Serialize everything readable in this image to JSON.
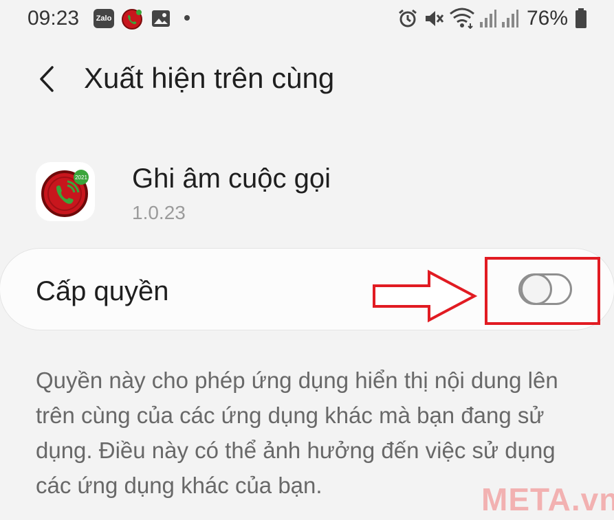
{
  "status_bar": {
    "time": "09:23",
    "zalo_label": "Zalo",
    "battery": "76%"
  },
  "header": {
    "title": "Xuất hiện trên cùng"
  },
  "app": {
    "name": "Ghi âm cuộc gọi",
    "version": "1.0.23",
    "icon_badge": "2021"
  },
  "permission": {
    "label": "Cấp quyền",
    "enabled": false
  },
  "description": "Quyền này cho phép ứng dụng hiển thị nội dung lên trên cùng của các ứng dụng khác mà bạn đang sử dụng. Điều này có thể ảnh hưởng đến việc sử dụng các ứng dụng khác của bạn.",
  "watermark": "META.vn",
  "colors": {
    "annotation": "#e11b22",
    "app_icon_red": "#c8161d",
    "app_icon_green": "#3aa53a"
  }
}
